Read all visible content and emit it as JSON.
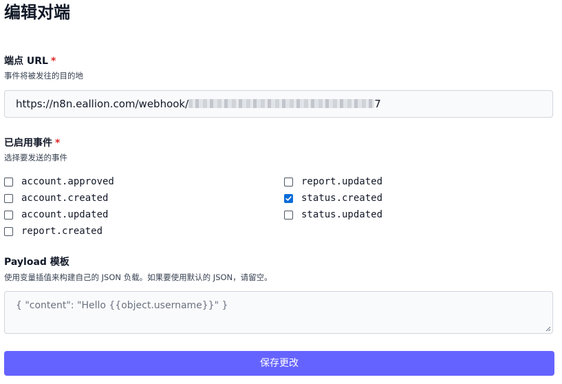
{
  "page": {
    "title": "编辑对端"
  },
  "endpoint": {
    "label": "端点 URL",
    "required_mark": "*",
    "hint": "事件将被发往的目的地",
    "value_prefix": "https://n8n.eallion.com/webhook/",
    "value_suffix": "7"
  },
  "events": {
    "label": "已启用事件",
    "required_mark": "*",
    "hint": "选择要发送的事件",
    "items": [
      {
        "label": "account.approved",
        "checked": false
      },
      {
        "label": "account.created",
        "checked": false
      },
      {
        "label": "account.updated",
        "checked": false
      },
      {
        "label": "report.created",
        "checked": false
      },
      {
        "label": "report.updated",
        "checked": false
      },
      {
        "label": "status.created",
        "checked": true
      },
      {
        "label": "status.updated",
        "checked": false
      }
    ]
  },
  "payload": {
    "label": "Payload 模板",
    "hint": "使用变量插值来构建自己的 JSON 负载。如果要使用默认的 JSON，请留空。",
    "placeholder": "{ \"content\": \"Hello {{object.username}}\" }"
  },
  "actions": {
    "save_label": "保存更改"
  },
  "colors": {
    "primary_button": "#6563ff",
    "required": "#dc2626",
    "checkbox_checked": "#0b6bd8"
  }
}
